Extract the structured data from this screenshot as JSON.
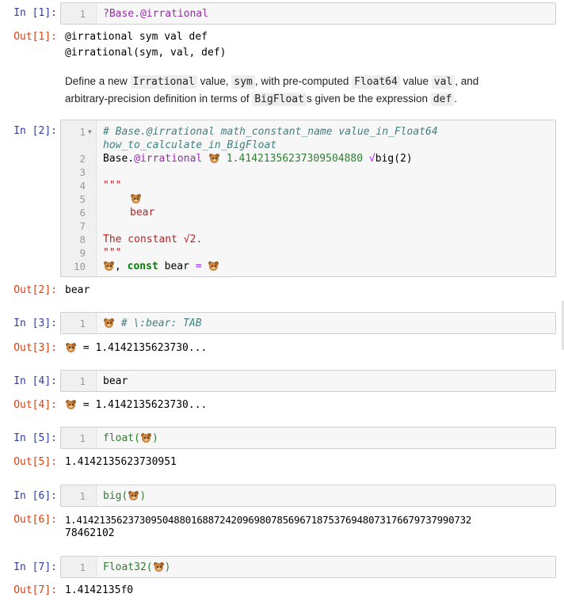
{
  "icons": {
    "bear": "bear-emoji-icon"
  },
  "cells": [
    {
      "in": "In [1]:",
      "out": "Out[1]:",
      "lines": [
        "1"
      ],
      "code1": "?Base.@irrational",
      "out_lines": [
        "@irrational sym val def",
        "@irrational(sym, val, def)"
      ],
      "doc": {
        "p1": "Define a new ",
        "c1": "Irrational",
        "p2": " value, ",
        "c2": "sym",
        "p3": ", with pre-computed ",
        "c3": "Float64",
        "p4": " value ",
        "c4": "val",
        "p5": ", and",
        "p6": "arbitrary-precision definition in terms of ",
        "c5": "BigFloat",
        "p7": "s given be the expression ",
        "c6": "def",
        "p8": "."
      }
    },
    {
      "in": "In [2]:",
      "out": "Out[2]:",
      "lines": [
        "1",
        "2",
        "3",
        "4",
        "5",
        "6",
        "7",
        "8",
        "9",
        "10"
      ],
      "l1": "# Base.@irrational math_constant_name value_in_Float64",
      "l1b": "how_to_calculate_in_BigFloat",
      "l2a": "Base.",
      "l2b": "@irrational",
      "l2c": "1.41421356237309504880",
      "l2d": "√",
      "l2e": "big(2)",
      "l4": "\"\"\"",
      "l6": "bear",
      "l8": "The constant √2.",
      "l9": "\"\"\"",
      "l10a": ", ",
      "l10b": "const",
      "l10c": " bear ",
      "l10d": "=",
      "out_text": "bear"
    },
    {
      "in": "In [3]:",
      "out": "Out[3]:",
      "lines": [
        "1"
      ],
      "code": "# \\:bear: TAB",
      "out_text": " = 1.4142135623730..."
    },
    {
      "in": "In [4]:",
      "out": "Out[4]:",
      "lines": [
        "1"
      ],
      "code": "bear",
      "out_text": " = 1.4142135623730..."
    },
    {
      "in": "In [5]:",
      "out": "Out[5]:",
      "lines": [
        "1"
      ],
      "code_a": "float(",
      "code_b": ")",
      "out_text": "1.4142135623730951"
    },
    {
      "in": "In [6]:",
      "out": "Out[6]:",
      "lines": [
        "1"
      ],
      "code_a": "big(",
      "code_b": ")",
      "out_l1": "1.414213562373095048801688724209698078569671875376948073176679737990732",
      "out_l2": "78462102"
    },
    {
      "in": "In [7]:",
      "out": "Out[7]:",
      "lines": [
        "1"
      ],
      "code_a": "Float32(",
      "code_b": ")",
      "out_text": "1.4142135f0"
    }
  ]
}
